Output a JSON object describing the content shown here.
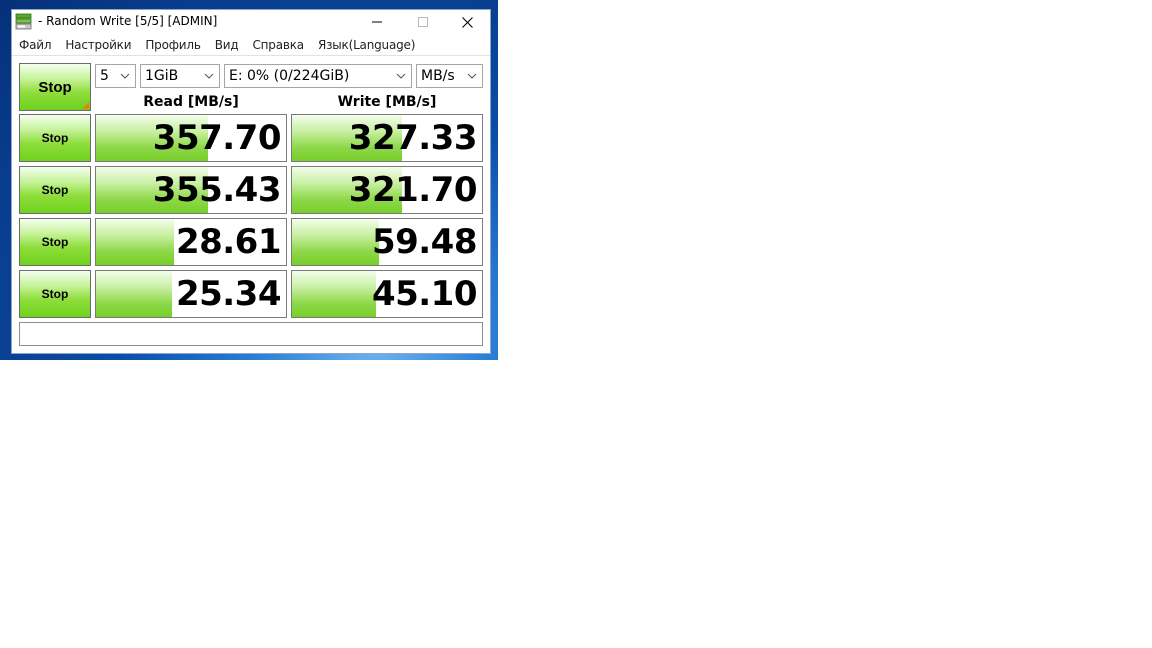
{
  "window": {
    "title": "- Random Write [5/5] [ADMIN]",
    "icon": "crystaldiskmark-icon"
  },
  "titlebar_buttons": [
    "minimize-icon",
    "maximize-icon",
    "close-icon"
  ],
  "menu": [
    "Файл",
    "Настройки",
    "Профиль",
    "Вид",
    "Справка",
    "Язык(Language)"
  ],
  "main_button": {
    "label": "Stop"
  },
  "settings": {
    "count": "5",
    "size": "1GiB",
    "drive": "E: 0% (0/224GiB)",
    "unit": "MB/s"
  },
  "headers": {
    "read": "Read [MB/s]",
    "write": "Write [MB/s]"
  },
  "rows": [
    {
      "stop_label": "Stop",
      "read": "357.70",
      "write": "327.33"
    },
    {
      "stop_label": "Stop",
      "read": "355.43",
      "write": "321.70"
    },
    {
      "stop_label": "Stop",
      "read": "28.61",
      "write": "59.48"
    },
    {
      "stop_label": "Stop",
      "read": "25.34",
      "write": "45.10"
    }
  ],
  "bar_fraction": {
    "read": [
      0.59,
      0.59,
      0.41,
      0.4
    ],
    "write": [
      0.58,
      0.58,
      0.46,
      0.44
    ]
  },
  "comment": "",
  "colors": {
    "accent_green": "#78cf2a",
    "corner_orange": "#f07c12"
  }
}
